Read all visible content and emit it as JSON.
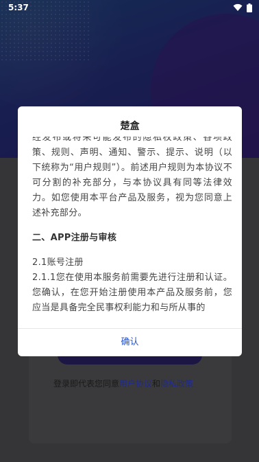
{
  "status_bar": {
    "time": "5:37"
  },
  "login": {
    "agree_prefix": "登录即代表您同意",
    "user_agreement": "用户协议",
    "and": "和",
    "privacy_policy": "隐私政策"
  },
  "dialog": {
    "title": "楚盒",
    "paragraph_1": "经发布或将来可能发布的隐私权政策、各项政策、规则、声明、通知、警示、提示、说明（以下统称为“用户规则”）。前述用户规则为本协议不可分割的补充部分，与本协议具有同等法律效力。如您使用本平台产品及服务，视为您同意上述补充部分。",
    "section_2_title": "二、APP注册与审核",
    "subsection_2_1": "2.1账号注册",
    "paragraph_2_1_1": "2.1.1您在使用本服务前需要先进行注册和认证。您确认，在您开始注册使用本产品及服务前，您应当是具备完全民事权利能力和与所从事的",
    "confirm_label": "确认"
  },
  "icons": {
    "wifi": "wifi-icon",
    "battery": "battery-icon"
  },
  "colors": {
    "accent": "#2a55c9",
    "header_gradient_start": "#2c5fb3",
    "header_gradient_end": "#3b2d99",
    "link": "#1f2a8a"
  }
}
